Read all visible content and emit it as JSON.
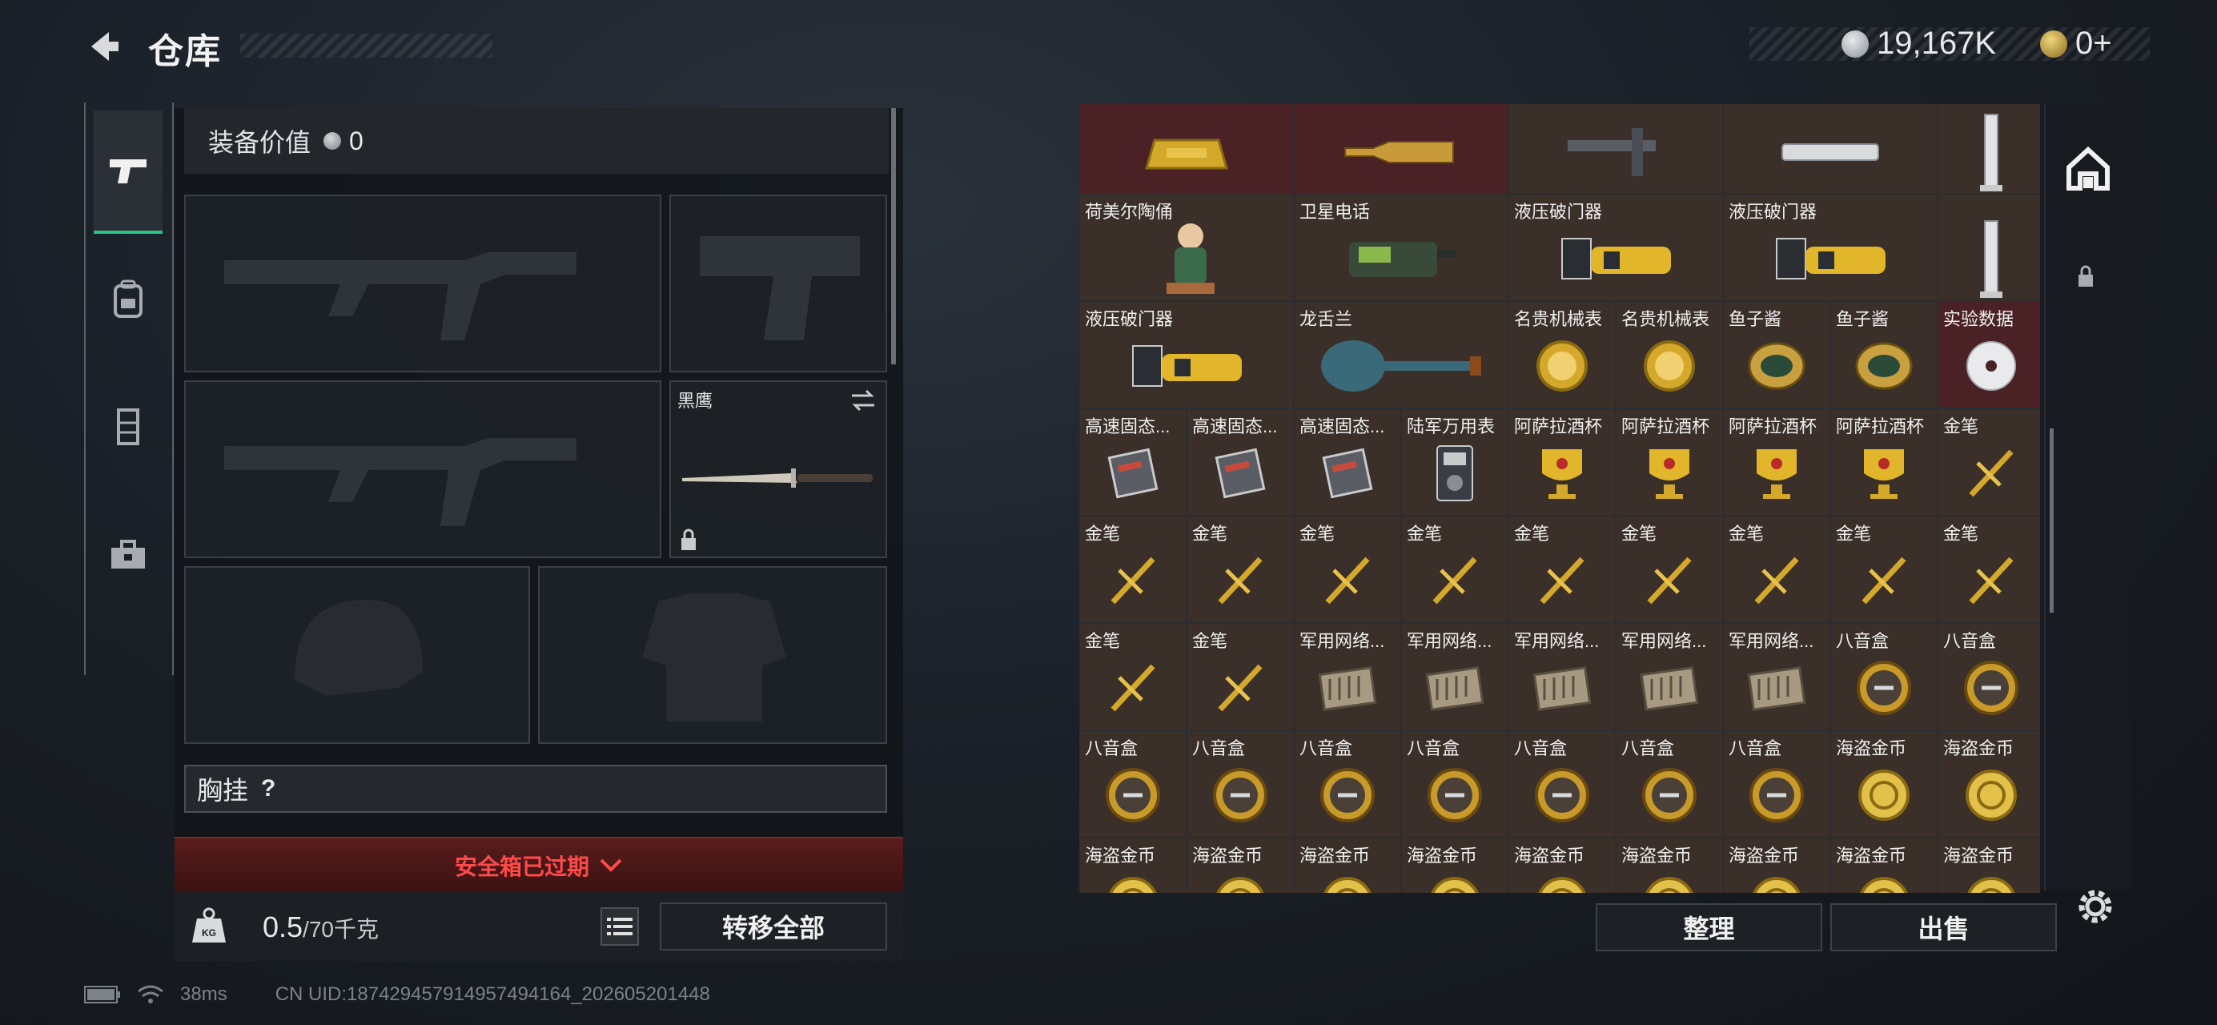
{
  "header": {
    "title": "仓库",
    "currency": [
      {
        "value": "19,167K"
      },
      {
        "value": "0+"
      }
    ]
  },
  "side_tabs": [
    {
      "icon": "pistol-icon",
      "active": true
    },
    {
      "icon": "backpack-icon",
      "active": false
    },
    {
      "icon": "vest-icon",
      "active": false
    },
    {
      "icon": "toolbox-icon",
      "active": false
    }
  ],
  "equipment": {
    "value_label": "装备价值",
    "value": "0",
    "melee_name": "黑鹰",
    "chest_rig_label": "胸挂",
    "chest_rig_help": "?",
    "expired_text": "安全箱已过期",
    "weight_current": "0.5",
    "weight_max": "/70千克",
    "transfer_all": "转移全部"
  },
  "inventory": {
    "top_row": [
      {
        "label": "",
        "icon": "gold-bar-icon",
        "red": true
      },
      {
        "label": "",
        "icon": "bottle-icon",
        "red": true
      },
      {
        "label": "",
        "icon": "scope-icon",
        "red": false
      },
      {
        "label": "",
        "icon": "tube-icon",
        "red": false
      },
      {
        "label": "",
        "icon": "pillar-icon",
        "red": false
      }
    ],
    "row2": [
      {
        "label": "荷美尔陶俑",
        "icon": "figurine-icon"
      },
      {
        "label": "卫星电话",
        "icon": "satphone-icon"
      },
      {
        "label": "液压破门器",
        "icon": "breacher-icon"
      },
      {
        "label": "液压破门器",
        "icon": "breacher-icon"
      },
      {
        "label": "",
        "icon": "pillar-icon"
      }
    ],
    "row3": [
      {
        "label": "液压破门器",
        "icon": "breacher-icon",
        "span": 2
      },
      {
        "label": "龙舌兰",
        "icon": "tequila-icon",
        "span": 2
      },
      {
        "label": "名贵机械表",
        "icon": "watch-icon",
        "span": 1
      },
      {
        "label": "名贵机械表",
        "icon": "watch-icon",
        "span": 1
      },
      {
        "label": "鱼子酱",
        "icon": "caviar-icon",
        "span": 1
      },
      {
        "label": "鱼子酱",
        "icon": "caviar-icon",
        "span": 1
      },
      {
        "label": "实验数据",
        "icon": "disc-icon",
        "span": 1,
        "red": true
      }
    ],
    "small_rows": [
      [
        {
          "label": "高速固态...",
          "icon": "ssd-icon"
        },
        {
          "label": "高速固态...",
          "icon": "ssd-icon"
        },
        {
          "label": "高速固态...",
          "icon": "ssd-icon"
        },
        {
          "label": "陆军万用表",
          "icon": "multimeter-icon"
        },
        {
          "label": "阿萨拉酒杯",
          "icon": "goblet-icon"
        },
        {
          "label": "阿萨拉酒杯",
          "icon": "goblet-icon"
        },
        {
          "label": "阿萨拉酒杯",
          "icon": "goblet-icon"
        },
        {
          "label": "阿萨拉酒杯",
          "icon": "goblet-icon"
        },
        {
          "label": "金笔",
          "icon": "gold-pen-icon"
        }
      ],
      [
        {
          "label": "金笔",
          "icon": "gold-pen-icon"
        },
        {
          "label": "金笔",
          "icon": "gold-pen-icon"
        },
        {
          "label": "金笔",
          "icon": "gold-pen-icon"
        },
        {
          "label": "金笔",
          "icon": "gold-pen-icon"
        },
        {
          "label": "金笔",
          "icon": "gold-pen-icon"
        },
        {
          "label": "金笔",
          "icon": "gold-pen-icon"
        },
        {
          "label": "金笔",
          "icon": "gold-pen-icon"
        },
        {
          "label": "金笔",
          "icon": "gold-pen-icon"
        },
        {
          "label": "金笔",
          "icon": "gold-pen-icon"
        }
      ],
      [
        {
          "label": "金笔",
          "icon": "gold-pen-icon"
        },
        {
          "label": "金笔",
          "icon": "gold-pen-icon"
        },
        {
          "label": "军用网络...",
          "icon": "network-module-icon"
        },
        {
          "label": "军用网络...",
          "icon": "network-module-icon"
        },
        {
          "label": "军用网络...",
          "icon": "network-module-icon"
        },
        {
          "label": "军用网络...",
          "icon": "network-module-icon"
        },
        {
          "label": "军用网络...",
          "icon": "network-module-icon"
        },
        {
          "label": "八音盒",
          "icon": "music-box-icon"
        },
        {
          "label": "八音盒",
          "icon": "music-box-icon"
        }
      ],
      [
        {
          "label": "八音盒",
          "icon": "music-box-icon"
        },
        {
          "label": "八音盒",
          "icon": "music-box-icon"
        },
        {
          "label": "八音盒",
          "icon": "music-box-icon"
        },
        {
          "label": "八音盒",
          "icon": "music-box-icon"
        },
        {
          "label": "八音盒",
          "icon": "music-box-icon"
        },
        {
          "label": "八音盒",
          "icon": "music-box-icon"
        },
        {
          "label": "八音盒",
          "icon": "music-box-icon"
        },
        {
          "label": "海盗金币",
          "icon": "pirate-coin-icon"
        },
        {
          "label": "海盗金币",
          "icon": "pirate-coin-icon"
        }
      ],
      [
        {
          "label": "海盗金币",
          "icon": "pirate-coin-icon"
        },
        {
          "label": "海盗金币",
          "icon": "pirate-coin-icon"
        },
        {
          "label": "海盗金币",
          "icon": "pirate-coin-icon"
        },
        {
          "label": "海盗金币",
          "icon": "pirate-coin-icon"
        },
        {
          "label": "海盗金币",
          "icon": "pirate-coin-icon"
        },
        {
          "label": "海盗金币",
          "icon": "pirate-coin-icon"
        },
        {
          "label": "海盗金币",
          "icon": "pirate-coin-icon"
        },
        {
          "label": "海盗金币",
          "icon": "pirate-coin-icon"
        },
        {
          "label": "海盗金币",
          "icon": "pirate-coin-icon"
        }
      ]
    ]
  },
  "actions": {
    "organize": "整理",
    "sell": "出售"
  },
  "status": {
    "ping": "38ms",
    "uid": "CN UID:18742945791495749416​4_202605201448"
  }
}
